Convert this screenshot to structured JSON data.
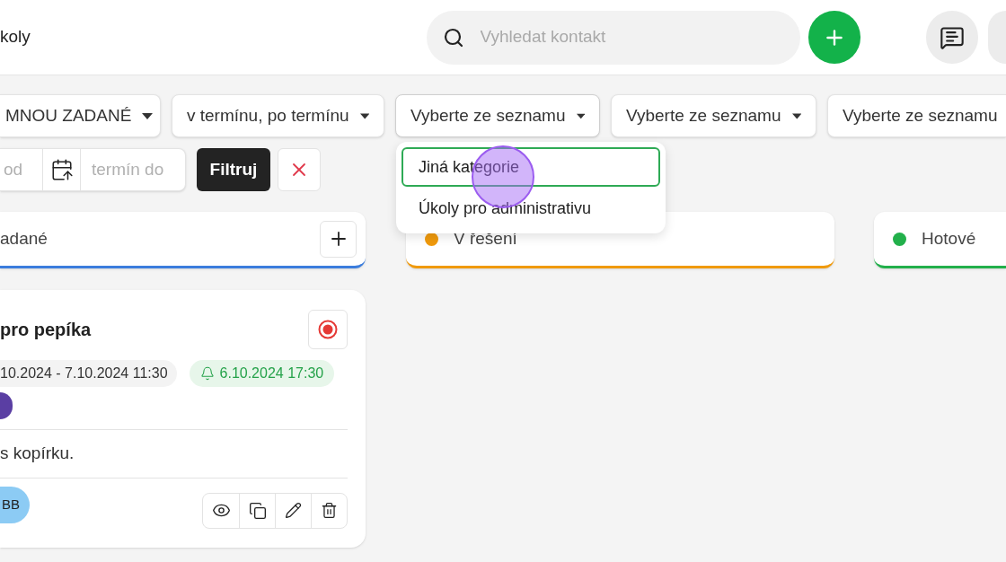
{
  "header": {
    "title": "koly",
    "search": {
      "placeholder": "Vyhledat kontakt"
    }
  },
  "filters": [
    {
      "value": "MNOU ZADANÉ",
      "caret": true,
      "open": false
    },
    {
      "value": "v termínu, po termínu",
      "caret": true,
      "open": false
    },
    {
      "value": "Vyberte ze seznamu",
      "caret": true,
      "open": true
    },
    {
      "value": "Vyberte ze seznamu",
      "caret": true,
      "open": false
    },
    {
      "value": "Vyberte ze seznamu",
      "caret": false,
      "open": false
    }
  ],
  "dropdown": {
    "items": [
      {
        "label": "Jiná kategorie",
        "selected": true
      },
      {
        "label": "Úkoly pro administrativu",
        "selected": false
      }
    ]
  },
  "date_range": {
    "from_placeholder": "od",
    "to_placeholder": "termín do"
  },
  "filter_button": "Filtruj",
  "columns": [
    {
      "title": "adané",
      "color": "#3b7ddd",
      "dot": false,
      "add_button": true
    },
    {
      "title": "V řešení",
      "color": "#f09a0c",
      "dot": true,
      "add_button": false
    },
    {
      "title": "Hotové",
      "color": "#22b04b",
      "dot": true,
      "add_button": false
    }
  ],
  "card": {
    "title": "pro pepíka",
    "date_range": "10.2024 - 7.10.2024 11:30",
    "reminder": "6.10.2024 17:30",
    "description": "s kopírku.",
    "assignee": "BB"
  }
}
